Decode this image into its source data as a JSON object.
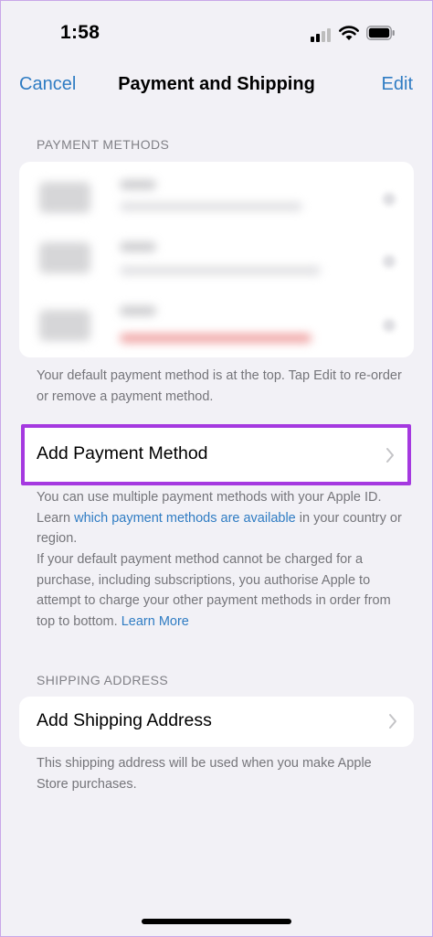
{
  "status_bar": {
    "time": "1:58",
    "icons": [
      "cellular-signal-icon",
      "wifi-icon",
      "battery-icon"
    ]
  },
  "nav": {
    "cancel_label": "Cancel",
    "title": "Payment and Shipping",
    "edit_label": "Edit"
  },
  "payment_methods": {
    "header": "PAYMENT METHODS",
    "items_blurred": 3,
    "accent_color": "#f06a6a",
    "footer": "Your default payment method is at the top. Tap Edit to re-order or remove a payment method."
  },
  "add_payment": {
    "label": "Add Payment Method",
    "highlight_color": "#a539e0",
    "info_prefix": "You can use multiple payment methods with your Apple ID. Learn ",
    "info_link": "which payment methods are available",
    "info_suffix": " in your country or region.",
    "authorise_text": "If your default payment method cannot be charged for a purchase, including subscriptions, you authorise Apple to attempt to charge your other payment methods in order from top to bottom. ",
    "learn_more": "Learn More"
  },
  "shipping": {
    "header": "SHIPPING ADDRESS",
    "add_label": "Add Shipping Address",
    "footer": "This shipping address will be used when you make Apple Store purchases."
  },
  "colors": {
    "background": "#f2f1f6",
    "link": "#2f7cc3",
    "secondary_text": "#75757a"
  }
}
